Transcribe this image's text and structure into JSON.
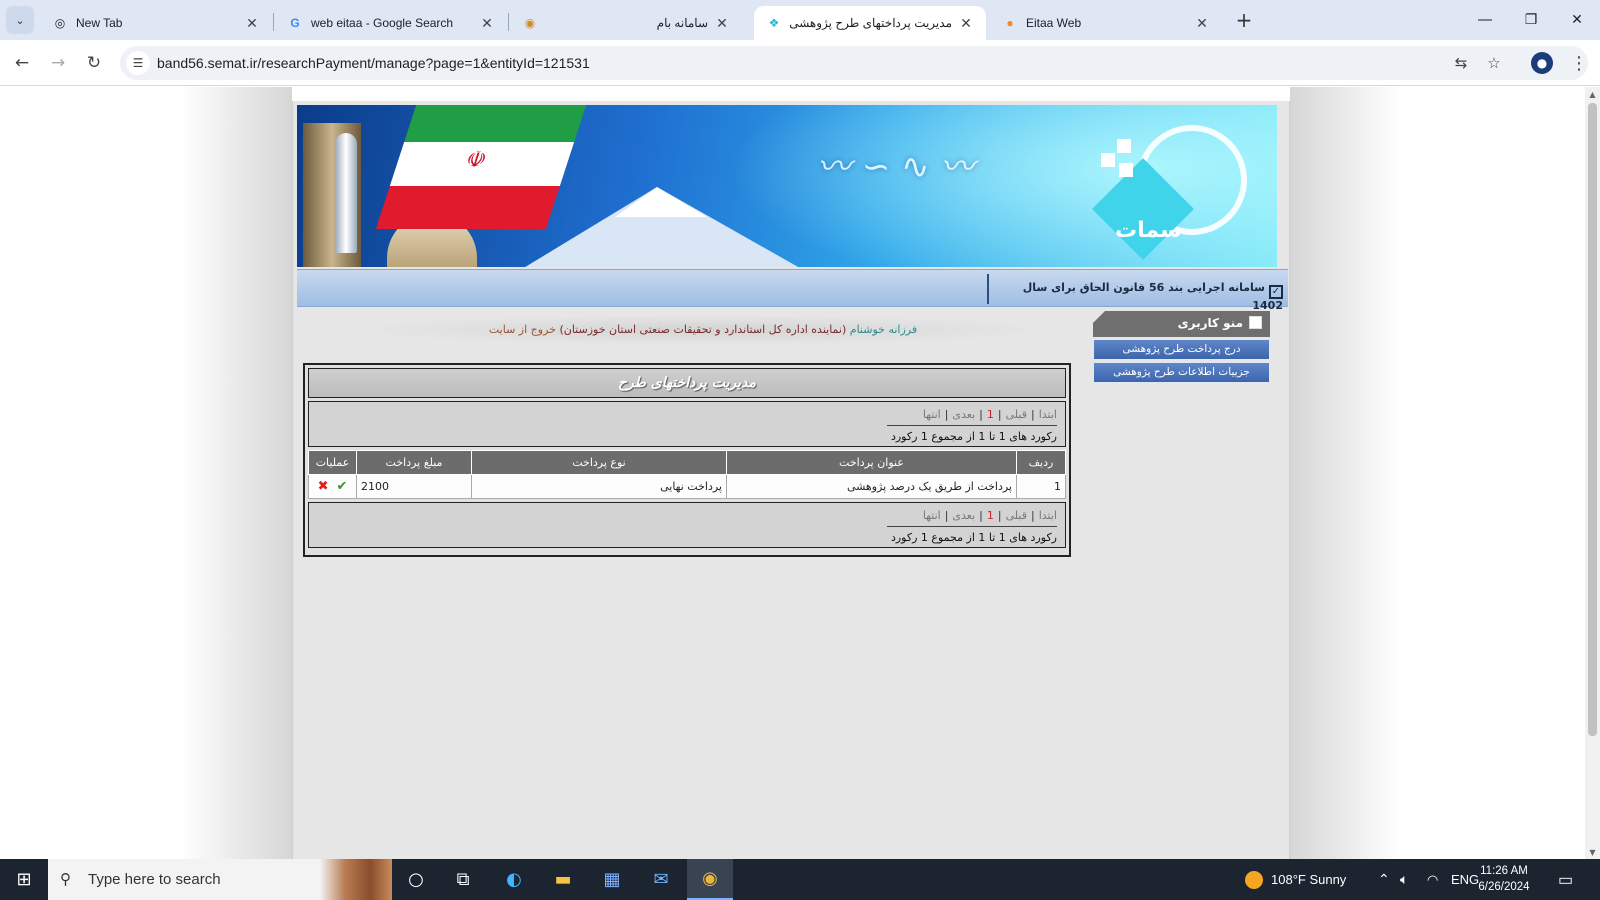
{
  "browser": {
    "tabs": [
      {
        "title": "New Tab",
        "icon": "chrome-icon",
        "close": "✕"
      },
      {
        "title": "web eitaa - Google Search",
        "icon": "google-icon",
        "close": "✕"
      },
      {
        "title": "سامانه بام",
        "icon": "bam-icon",
        "close": "✕"
      },
      {
        "title": "مدیریت پرداختهای طرح پژوهشی",
        "icon": "semat-icon",
        "close": "✕"
      },
      {
        "title": "Eitaa Web",
        "icon": "eitaa-icon",
        "close": "✕"
      }
    ],
    "active_tab_index": 3,
    "url": "band56.semat.ir/researchPayment/manage?page=1&entityId=121531"
  },
  "page": {
    "system_title": "سامانه اجرایی بند 56 قانون الحاق برای سال 1402",
    "welcome": {
      "name": "فرزانه خوشنام",
      "org": "(نماینده اداره کل استاندارد و تحقیقات صنعتی استان خوزستان)",
      "logout": "خروج از سایت"
    },
    "user_menu": {
      "title": "منو کاربری",
      "items": [
        "درج پرداخت طرح پژوهشی",
        "جزییات اطلاعات طرح پژوهشی"
      ]
    },
    "panel_title": "مدیریت پرداختهای طرح",
    "pager": {
      "first": "ابتدا",
      "prev": "قبلی",
      "current": "1",
      "next": "بعدی",
      "last": "انتها",
      "summary": "رکورد های 1 تا 1 از مجموع 1 رکورد"
    },
    "table": {
      "headers": [
        "ردیف",
        "عنوان پرداخت",
        "نوع پرداخت",
        "مبلغ پرداخت",
        "عملیات"
      ],
      "rows": [
        {
          "index": "1",
          "title": "پرداخت از طریق یک درصد پژوهشی",
          "type": "پرداخت نهایی",
          "amount": "2100"
        }
      ]
    }
  },
  "taskbar": {
    "search_placeholder": "Type here to search",
    "weather": "108°F  Sunny",
    "language": "ENG",
    "time": "11:26 AM",
    "date": "6/26/2024"
  }
}
